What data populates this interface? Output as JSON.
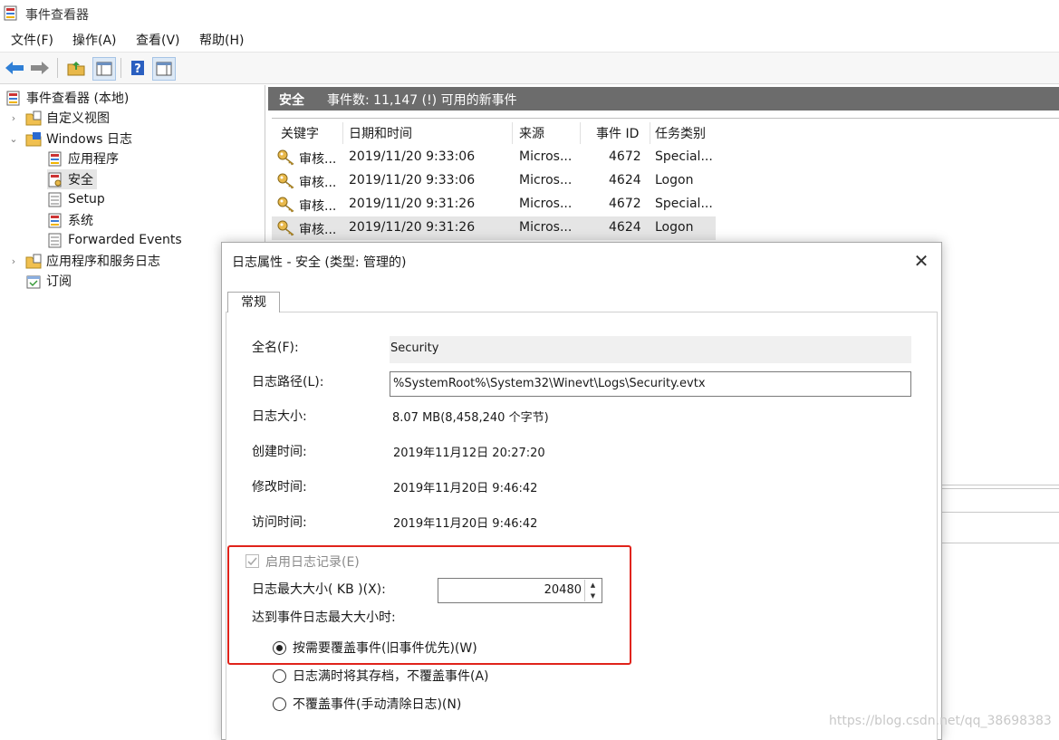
{
  "window": {
    "title": "事件查看器"
  },
  "menu": [
    "文件(F)",
    "操作(A)",
    "查看(V)",
    "帮助(H)"
  ],
  "tree": {
    "root": "事件查看器 (本地)",
    "custom_views": "自定义视图",
    "windows_logs": "Windows 日志",
    "application": "应用程序",
    "security": "安全",
    "setup": "Setup",
    "system": "系统",
    "forwarded": "Forwarded Events",
    "app_service_logs": "应用程序和服务日志",
    "subscriptions": "订阅"
  },
  "pane": {
    "name": "安全",
    "count": "事件数: 11,147 (!) 可用的新事件",
    "columns": [
      "关键字",
      "日期和时间",
      "来源",
      "事件 ID",
      "任务类别"
    ],
    "rows": [
      [
        "审核...",
        "2019/11/20 9:33:06",
        "Micros...",
        "4672",
        "Special..."
      ],
      [
        "审核...",
        "2019/11/20 9:33:06",
        "Micros...",
        "4624",
        "Logon"
      ],
      [
        "审核...",
        "2019/11/20 9:31:26",
        "Micros...",
        "4672",
        "Special..."
      ],
      [
        "审核...",
        "2019/11/20 9:31:26",
        "Micros...",
        "4624",
        "Logon"
      ]
    ]
  },
  "dialog": {
    "title": "日志属性 - 安全 (类型: 管理的)",
    "tab": "常规",
    "fullname_label": "全名(F):",
    "fullname_value": "Security",
    "path_label": "日志路径(L):",
    "path_value": "%SystemRoot%\\System32\\Winevt\\Logs\\Security.evtx",
    "size_label": "日志大小:",
    "size_value": "8.07 MB(8,458,240 个字节)",
    "created_label": "创建时间:",
    "created_value": "2019年11月12日 20:27:20",
    "modified_label": "修改时间:",
    "modified_value": "2019年11月20日 9:46:42",
    "accessed_label": "访问时间:",
    "accessed_value": "2019年11月20日 9:46:42",
    "enable_label": "启用日志记录(E)",
    "maxsize_label": "日志最大大小( KB )(X):",
    "maxsize_value": "20480",
    "when_full_label": "达到事件日志最大大小时:",
    "opt_overwrite": "按需要覆盖事件(旧事件优先)(W)",
    "opt_archive": "日志满时将其存档，不覆盖事件(A)",
    "opt_no_overwrite": "不覆盖事件(手动清除日志)(N)"
  },
  "watermark": "https://blog.csdn.net/qq_38698383",
  "colors": {
    "accent_red": "#e0231b",
    "header_gray": "#6c6c6c"
  }
}
